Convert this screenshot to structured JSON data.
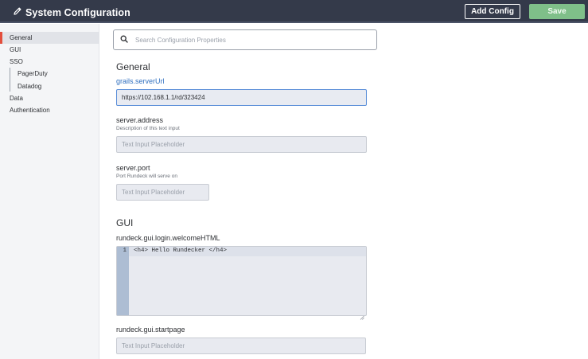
{
  "header": {
    "title": "System Configuration",
    "add_config_label": "Add Config",
    "save_label": "Save"
  },
  "sidebar": {
    "items": [
      {
        "label": "General",
        "active": true
      },
      {
        "label": "GUI"
      },
      {
        "label": "SSO"
      },
      {
        "label": "PagerDuty",
        "sub": true
      },
      {
        "label": "Datadog",
        "sub": true
      },
      {
        "label": "Data"
      },
      {
        "label": "Authentication"
      }
    ]
  },
  "search": {
    "placeholder": "Search Configuration Properties"
  },
  "sections": {
    "general": {
      "title": "General",
      "server_url": {
        "label": "grails.serverUrl",
        "value": "https://102.168.1.1/rd/323424"
      },
      "server_address": {
        "label": "server.address",
        "description": "Description of this text input",
        "placeholder": "Text Input Placeholder"
      },
      "server_port": {
        "label": "server.port",
        "description": "Port Rundeck will serve on",
        "placeholder": "Text Input Placeholder"
      }
    },
    "gui": {
      "title": "GUI",
      "welcome_html": {
        "label": "rundeck.gui.login.welcomeHTML",
        "line_number": "1",
        "code": "<h4> Hello Rundecker </h4>"
      },
      "startpage": {
        "label": "rundeck.gui.startpage",
        "placeholder": "Text Input Placeholder"
      }
    }
  },
  "colors": {
    "header_bg": "#343a4a",
    "save_button": "#7fbf89",
    "link": "#2f6fbf",
    "active_indicator": "#e34e3c"
  }
}
